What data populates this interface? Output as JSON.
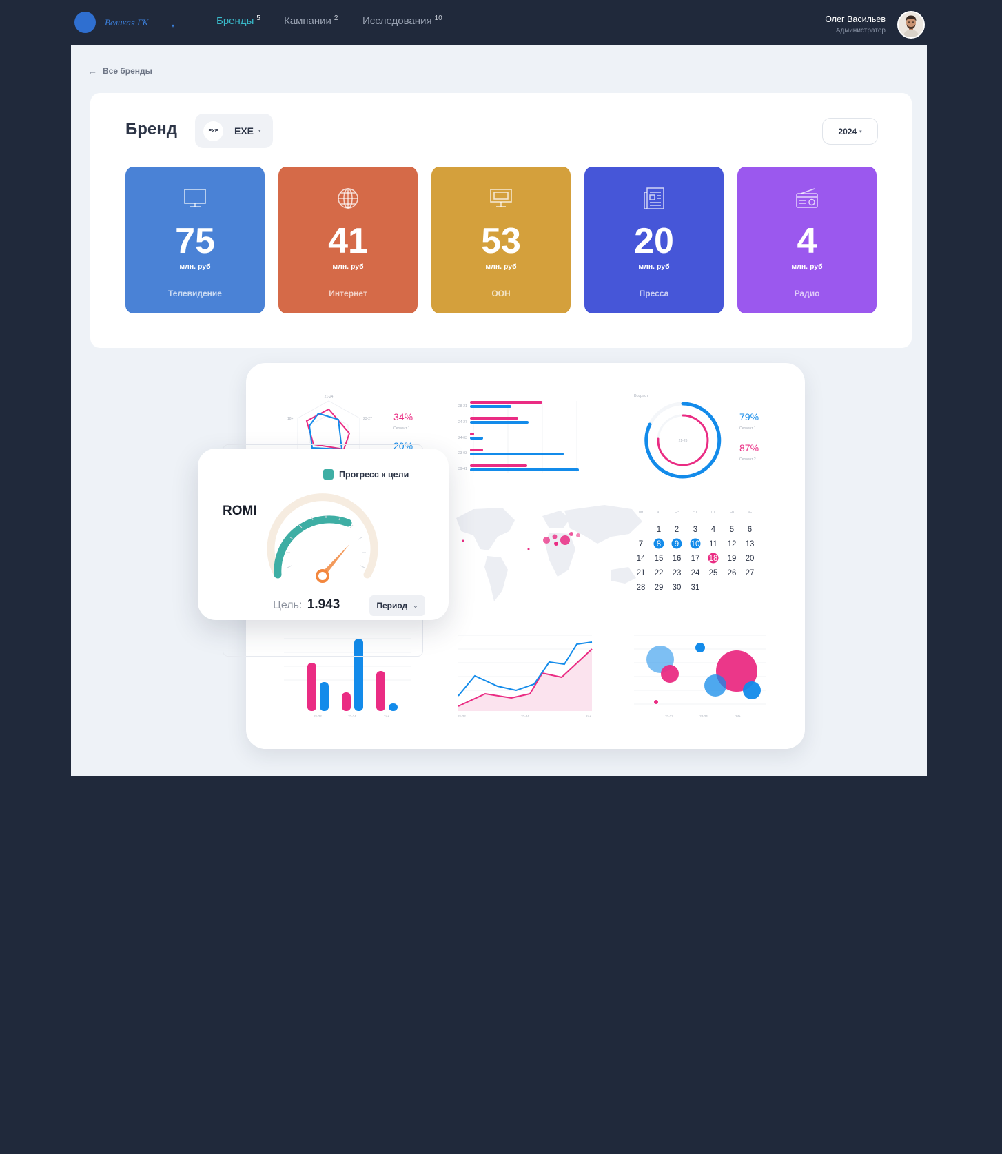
{
  "app": {
    "logo_text": "Великая ГК"
  },
  "nav": [
    {
      "label": "Бренды",
      "count": "5",
      "active": true
    },
    {
      "label": "Кампании",
      "count": "2",
      "active": false
    },
    {
      "label": "Исследования",
      "count": "10",
      "active": false
    }
  ],
  "user": {
    "name": "Олег Васильев",
    "role": "Администратор"
  },
  "breadcrumb": {
    "back_label": "Все бренды"
  },
  "brand": {
    "title": "Бренд",
    "selected_brand": "EXE",
    "brand_logo_text": "EXE",
    "year": "2024"
  },
  "media": [
    {
      "value": "75",
      "unit": "млн. руб",
      "label": "Телевидение",
      "color": "#4a82d6",
      "icon": "tv-icon"
    },
    {
      "value": "41",
      "unit": "млн. руб",
      "label": "Интернет",
      "color": "#d56a48",
      "icon": "globe-icon"
    },
    {
      "value": "53",
      "unit": "млн. руб",
      "label": "ООН",
      "color": "#d4a03c",
      "icon": "billboard-icon"
    },
    {
      "value": "20",
      "unit": "млн. руб",
      "label": "Пресса",
      "color": "#4656d8",
      "icon": "newspaper-icon"
    },
    {
      "value": "4",
      "unit": "млн. руб",
      "label": "Радио",
      "color": "#9b58ee",
      "icon": "radio-icon"
    }
  ],
  "preview": {
    "radar": {
      "label_top": "21-24",
      "label_left": "18+",
      "label_right": "23-27",
      "segment1_value": "34%",
      "segment1_label": "Сегмент 1",
      "segment2_value": "20%"
    },
    "hbars": {
      "labels": [
        "28-21",
        "24-27",
        "24-03",
        "23-03",
        "39-41"
      ]
    },
    "donut": {
      "label": "Возраст",
      "center_label": "21-26",
      "segment1_value": "79%",
      "segment1_label": "Сегмент 1",
      "segment2_value": "87%",
      "segment2_label": "Сегмент 2"
    },
    "calendar": {
      "weekdays": [
        "ПН",
        "ВТ",
        "СР",
        "ЧТ",
        "ПТ",
        "СБ",
        "ВС"
      ],
      "weeks": [
        [
          "",
          "1",
          "2",
          "3",
          "4",
          "5",
          "6"
        ],
        [
          "7",
          "8",
          "9",
          "10",
          "11",
          "12",
          "13"
        ],
        [
          "14",
          "15",
          "16",
          "17",
          "18",
          "19",
          "20"
        ],
        [
          "21",
          "22",
          "23",
          "24",
          "25",
          "26",
          "27"
        ],
        [
          "28",
          "29",
          "30",
          "31",
          "",
          "",
          ""
        ]
      ],
      "highlight_blue": [
        "8",
        "9",
        "10"
      ],
      "highlight_pink": [
        "18"
      ]
    },
    "vbars": {
      "labels": [
        "21-22",
        "22-24",
        "24+"
      ]
    },
    "line": {
      "labels": [
        "21-22",
        "22-24",
        "24+"
      ]
    },
    "bubbles": {
      "labels": [
        "21-22",
        "22-24",
        "24+"
      ]
    }
  },
  "romi": {
    "title": "ROMI",
    "legend": "Прогресс к цели",
    "goal_label": "Цель:",
    "goal_value": "1.943",
    "period_label": "Период"
  },
  "colors": {
    "blue": "#138bea",
    "pink": "#ea2c83",
    "teal": "#3eaea4",
    "navy": "#20293b"
  }
}
